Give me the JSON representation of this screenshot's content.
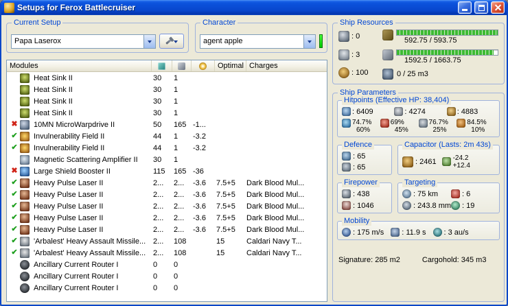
{
  "window": {
    "title": "Setups for Ferox Battlecruiser"
  },
  "current_setup": {
    "label": "Current Setup",
    "value": "Papa Laserox"
  },
  "character": {
    "label": "Character",
    "value": "agent apple"
  },
  "modules_table": {
    "headers": {
      "modules": "Modules",
      "optimal": "Optimal",
      "charges": "Charges"
    },
    "status_glyphs": {
      "ok": "✔",
      "error": "✖"
    },
    "rows": [
      {
        "status": "",
        "icon": "heat-sink-icon",
        "name": "Heat Sink II",
        "cpu": "30",
        "pg": "1",
        "cap": "",
        "optimal": "",
        "charges": ""
      },
      {
        "status": "",
        "icon": "heat-sink-icon",
        "name": "Heat Sink II",
        "cpu": "30",
        "pg": "1",
        "cap": "",
        "optimal": "",
        "charges": ""
      },
      {
        "status": "",
        "icon": "heat-sink-icon",
        "name": "Heat Sink II",
        "cpu": "30",
        "pg": "1",
        "cap": "",
        "optimal": "",
        "charges": ""
      },
      {
        "status": "",
        "icon": "heat-sink-icon",
        "name": "Heat Sink II",
        "cpu": "30",
        "pg": "1",
        "cap": "",
        "optimal": "",
        "charges": ""
      },
      {
        "status": "error",
        "icon": "mwd-icon",
        "name": "10MN MicroWarpdrive II",
        "cpu": "50",
        "pg": "165",
        "cap": "-1...",
        "optimal": "",
        "charges": ""
      },
      {
        "status": "ok",
        "icon": "invuln-field-icon",
        "name": "Invulnerability Field II",
        "cpu": "44",
        "pg": "1",
        "cap": "-3.2",
        "optimal": "",
        "charges": ""
      },
      {
        "status": "ok",
        "icon": "invuln-field-icon",
        "name": "Invulnerability Field II",
        "cpu": "44",
        "pg": "1",
        "cap": "-3.2",
        "optimal": "",
        "charges": ""
      },
      {
        "status": "",
        "icon": "amplifier-icon",
        "name": "Magnetic Scattering Amplifier II",
        "cpu": "30",
        "pg": "1",
        "cap": "",
        "optimal": "",
        "charges": ""
      },
      {
        "status": "error",
        "icon": "shield-booster-icon",
        "name": "Large Shield Booster II",
        "cpu": "115",
        "pg": "165",
        "cap": "-36",
        "optimal": "",
        "charges": ""
      },
      {
        "status": "ok",
        "icon": "pulse-laser-icon",
        "name": "Heavy Pulse Laser II",
        "cpu": "2...",
        "pg": "2...",
        "cap": "-3.6",
        "optimal": "7.5+5",
        "charges": "Dark Blood Mul..."
      },
      {
        "status": "ok",
        "icon": "pulse-laser-icon",
        "name": "Heavy Pulse Laser II",
        "cpu": "2...",
        "pg": "2...",
        "cap": "-3.6",
        "optimal": "7.5+5",
        "charges": "Dark Blood Mul..."
      },
      {
        "status": "ok",
        "icon": "pulse-laser-icon",
        "name": "Heavy Pulse Laser II",
        "cpu": "2...",
        "pg": "2...",
        "cap": "-3.6",
        "optimal": "7.5+5",
        "charges": "Dark Blood Mul..."
      },
      {
        "status": "ok",
        "icon": "pulse-laser-icon",
        "name": "Heavy Pulse Laser II",
        "cpu": "2...",
        "pg": "2...",
        "cap": "-3.6",
        "optimal": "7.5+5",
        "charges": "Dark Blood Mul..."
      },
      {
        "status": "ok",
        "icon": "pulse-laser-icon",
        "name": "Heavy Pulse Laser II",
        "cpu": "2...",
        "pg": "2...",
        "cap": "-3.6",
        "optimal": "7.5+5",
        "charges": "Dark Blood Mul..."
      },
      {
        "status": "ok",
        "icon": "missile-launcher-icon",
        "name": "'Arbalest' Heavy Assault Missile...",
        "cpu": "2...",
        "pg": "108",
        "cap": "",
        "optimal": "15",
        "charges": "Caldari Navy T..."
      },
      {
        "status": "ok",
        "icon": "missile-launcher-icon",
        "name": "'Arbalest' Heavy Assault Missile...",
        "cpu": "2...",
        "pg": "108",
        "cap": "",
        "optimal": "15",
        "charges": "Caldari Navy T..."
      },
      {
        "status": "",
        "icon": "power-router-icon",
        "name": "Ancillary Current Router I",
        "cpu": "0",
        "pg": "0",
        "cap": "",
        "optimal": "",
        "charges": ""
      },
      {
        "status": "",
        "icon": "power-router-icon",
        "name": "Ancillary Current Router I",
        "cpu": "0",
        "pg": "0",
        "cap": "",
        "optimal": "",
        "charges": ""
      },
      {
        "status": "",
        "icon": "power-router-icon",
        "name": "Ancillary Current Router I",
        "cpu": "0",
        "pg": "0",
        "cap": "",
        "optimal": "",
        "charges": ""
      }
    ]
  },
  "ship_resources": {
    "title": "Ship Resources",
    "turrets": ": 0",
    "launchers": ": 3",
    "calibration": ": 100",
    "cpu_value": "592.75 / 593.75",
    "cpu_fill_pct": 99.8,
    "powergrid_value": "1592.5 / 1663.75",
    "powergrid_fill_pct": 95.7,
    "dronebay_value": "0 / 25 m3"
  },
  "ship_parameters": {
    "title": "Ship Parameters",
    "hitpoints": {
      "title": "Hitpoints (Effective HP: 38,404)",
      "shield": ": 6409",
      "armor": ": 4274",
      "structure": ": 4883",
      "resists": [
        {
          "top": "74.7%",
          "bottom": "60%"
        },
        {
          "top": "69%",
          "bottom": "45%"
        },
        {
          "top": "76.7%",
          "bottom": "25%"
        },
        {
          "top": "84.5%",
          "bottom": "10%"
        }
      ]
    },
    "defence": {
      "title": "Defence",
      "shield_value": ": 65",
      "armor_value": ": 65"
    },
    "capacitor": {
      "title": "Capacitor (Lasts: 2m 43s)",
      "amount": ": 2461",
      "drain": "-24.2",
      "recharge": "+12.4"
    },
    "firepower": {
      "title": "Firepower",
      "turret_value": ": 438",
      "launcher_value": ": 1046"
    },
    "targeting": {
      "title": "Targeting",
      "range": ": 75 km",
      "max_targets": ": 6",
      "scan_resolution": ": 243.8 mm",
      "sensor_strength": ": 19"
    },
    "mobility": {
      "title": "Mobility",
      "speed": ": 175 m/s",
      "agility": ": 11.9 s",
      "warp_speed": ": 3 au/s"
    },
    "signature": "Signature: 285 m2",
    "cargohold": "Cargohold: 345 m3"
  }
}
